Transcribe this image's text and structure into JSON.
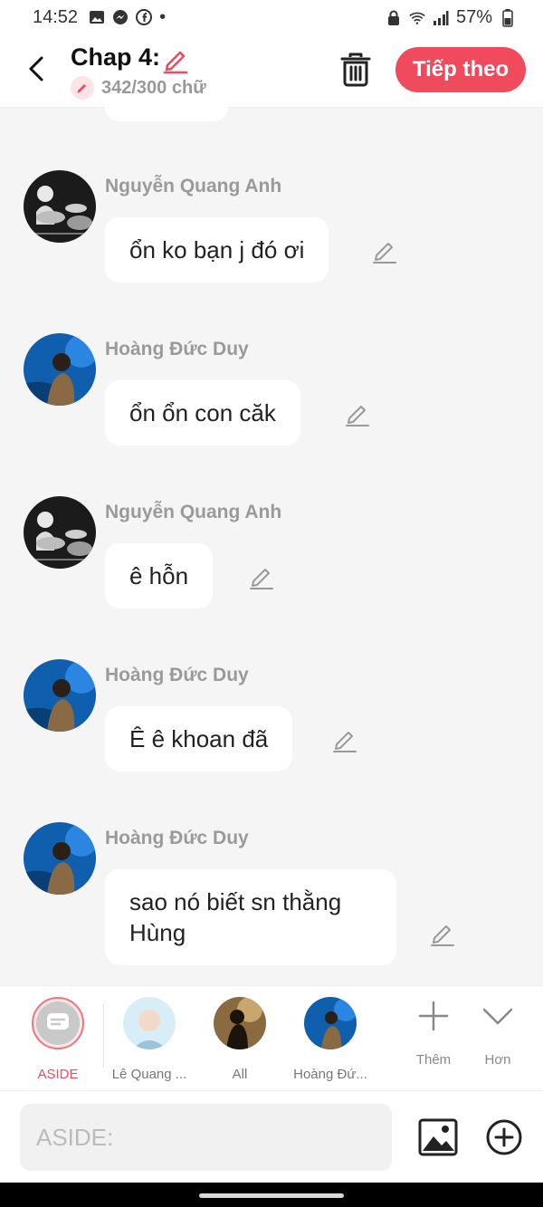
{
  "status_bar": {
    "time": "14:52",
    "dot": "•",
    "battery": "57%",
    "left_icons": [
      "gallery-icon",
      "messenger-icon",
      "facebook-icon"
    ],
    "right_icons": [
      "lock-icon",
      "wifi-icon",
      "signal-icon",
      "battery-icon"
    ]
  },
  "header": {
    "title": "Chap 4:",
    "word_count": "342/300 chữ",
    "next_label": "Tiếp theo",
    "accent_color": "#f04a5d"
  },
  "messages": [
    {
      "sender": "Nguyễn Quang Anh",
      "text": "ổn ko bạn j đó ơi",
      "avatar": "drummer-photo"
    },
    {
      "sender": "Hoàng Đức Duy",
      "text": "ổn ổn con căk",
      "avatar": "blue-portrait-photo"
    },
    {
      "sender": "Nguyễn Quang Anh",
      "text": "ê hỗn",
      "avatar": "drummer-photo"
    },
    {
      "sender": "Hoàng Đức Duy",
      "text": "Ê ê khoan đã",
      "avatar": "blue-portrait-photo"
    },
    {
      "sender": "Hoàng Đức Duy",
      "text": "sao nó biết sn thằng Hùng",
      "avatar": "blue-portrait-photo"
    }
  ],
  "cast": {
    "items": [
      {
        "label": "ASIDE",
        "type": "aside"
      },
      {
        "label": "Lê Quang ...",
        "type": "avatar"
      },
      {
        "label": "All",
        "type": "avatar"
      },
      {
        "label": "Hoàng Đứ...",
        "type": "avatar"
      }
    ],
    "add_label": "Thêm",
    "more_label": "Hơn"
  },
  "composer": {
    "placeholder": "ASIDE:"
  }
}
